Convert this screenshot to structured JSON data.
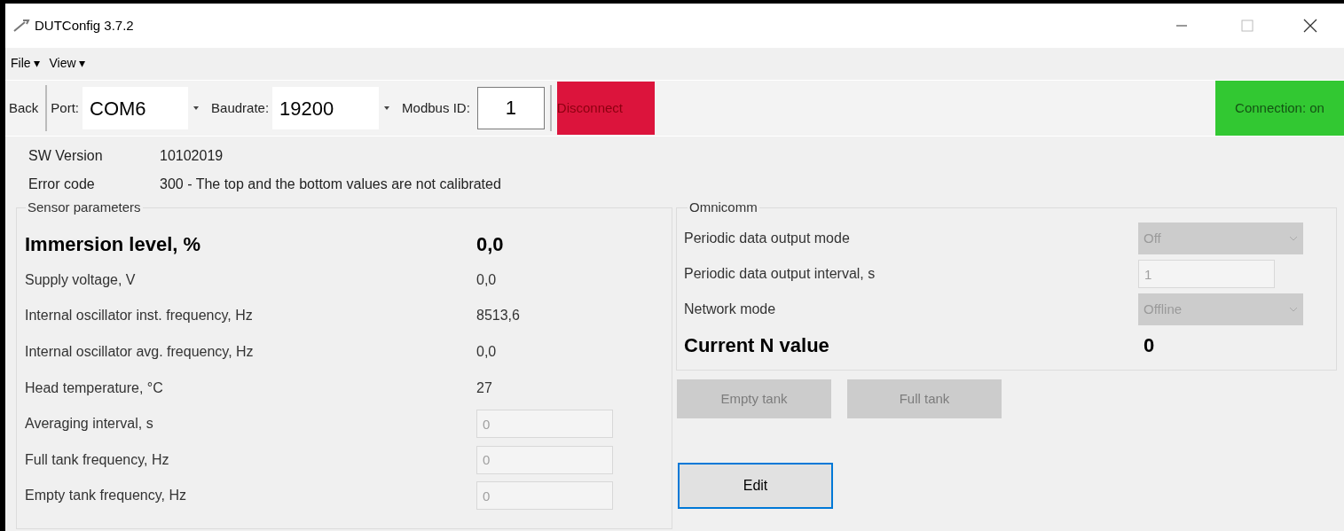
{
  "window": {
    "title": "DUTConfig 3.7.2"
  },
  "menu": [
    {
      "label": "File",
      "arrow": "▾"
    },
    {
      "label": "View",
      "arrow": "▾"
    }
  ],
  "toolbar": {
    "back": "Back",
    "port_label": "Port:",
    "port": "COM6",
    "baud_label": "Baudrate:",
    "baudrate": "19200",
    "modbus_label": "Modbus ID:",
    "modbus_id": "1",
    "disconnect": "Disconnect",
    "connection": "Connection: on",
    "connected": true
  },
  "info": [
    {
      "label": "SW Version",
      "value": "10102019"
    },
    {
      "label": "Error code",
      "value": "300 - The top and the bottom values are not calibrated"
    }
  ],
  "sensor_parameters": {
    "title": "Sensor parameters",
    "rows": [
      {
        "kind": "value",
        "label": "Immersion level, %",
        "value": "0,0",
        "bold": true
      },
      {
        "kind": "value",
        "label": "Supply voltage, V",
        "value": "0,0",
        "bold": false
      },
      {
        "kind": "value",
        "label": "Internal oscillator inst. frequency, Hz",
        "value": "8513,6",
        "bold": false
      },
      {
        "kind": "value",
        "label": "Internal oscillator avg. frequency, Hz",
        "value": "0,0",
        "bold": false
      },
      {
        "kind": "value",
        "label": "Head temperature, °C",
        "value": "27",
        "bold": false
      },
      {
        "kind": "input",
        "label": "Averaging interval, s",
        "value": "0",
        "disabled": true
      },
      {
        "kind": "input",
        "label": "Full tank frequency, Hz",
        "value": "0",
        "disabled": true
      },
      {
        "kind": "input",
        "label": "Empty tank frequency, Hz",
        "value": "0",
        "disabled": true
      }
    ]
  },
  "omnicomm": {
    "title": "Omnicomm",
    "rows": [
      {
        "kind": "dropdown",
        "label": "Periodic data output mode",
        "value": "Off",
        "disabled": true
      },
      {
        "kind": "input",
        "label": "Periodic data output interval, s",
        "value": "1",
        "disabled": true
      },
      {
        "kind": "dropdown",
        "label": "Network mode",
        "value": "Offline",
        "disabled": true
      },
      {
        "kind": "value",
        "label": "Current N value",
        "value": "0",
        "bold": true
      }
    ]
  },
  "tank_buttons": [
    {
      "label": "Empty tank",
      "disabled": true
    },
    {
      "label": "Full tank",
      "disabled": true
    }
  ],
  "edit_button": {
    "label": "Edit",
    "focused": true
  }
}
